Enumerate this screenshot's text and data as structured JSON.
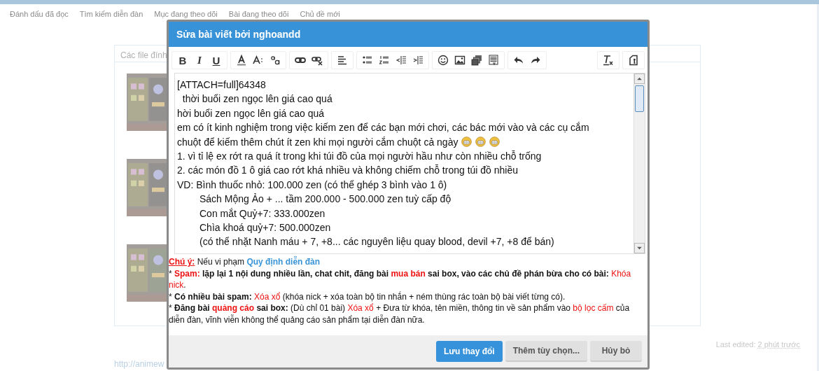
{
  "nav": [
    "Đánh dấu đã đọc",
    "Tìm kiếm diễn đàn",
    "Mục đang theo dõi",
    "Bài đang theo dõi",
    "Chủ đề mới"
  ],
  "attachments": {
    "title": "Các file đính"
  },
  "footer_link": "http://animew",
  "last_edited": {
    "label": "Last edited:",
    "time": "2 phút trước"
  },
  "dialog": {
    "title": "Sửa bài viết bởi nghoandd",
    "toolbar": {
      "format_buttons": [
        "B",
        "I",
        "U"
      ]
    },
    "editor_lines": [
      {
        "kind": "line",
        "text": "[ATTACH=full]64348"
      },
      {
        "kind": "line",
        "text": "  thời buổi zen ngọc lên giá cao quá"
      },
      {
        "kind": "line",
        "text": "hời buổi zen ngọc lên giá cao quá"
      },
      {
        "kind": "line",
        "text": "em có ít kinh nghiệm trong việc kiếm zen để các bạn mới chơi, các bác mới vào và các cụ cắm"
      },
      {
        "kind": "emoticons",
        "text": "chuột để kiếm thêm chút ít zen khi mọi người cắm chuột cả ngày"
      },
      {
        "kind": "line",
        "text": "1. vì tỉ lệ ex rớt ra quá ít trong khi túi đồ của mọi người hầu như còn nhiều chỗ trống"
      },
      {
        "kind": "line",
        "text": "2. các món đồ 1 ô giá cao rớt khá nhiều và không chiếm chỗ trong túi đồ nhiều"
      },
      {
        "kind": "line",
        "text": "VD: Bình thuốc nhỏ: 100.000 zen (có thể ghép 3 bình vào 1 ô)"
      },
      {
        "kind": "indented",
        "text": "Sách Mộng Ảo + ... tầm 200.000 - 500.000 zen tuỳ cấp độ"
      },
      {
        "kind": "indented",
        "text": "Con mắt Quỷ+7: 333.000zen"
      },
      {
        "kind": "indented",
        "text": "Chìa khoá quỷ+7: 500.000zen"
      },
      {
        "kind": "indented",
        "text": "(có thể nhặt Nanh máu + 7, +8... các nguyên liệu quay blood, devil +7, +8 để bán)"
      }
    ],
    "rules": [
      [
        {
          "kind": "warn",
          "text": "Chú ý:"
        },
        {
          "kind": "plain",
          "text": " Nếu vi phạm "
        },
        {
          "kind": "link",
          "text": "Quy định diễn đàn"
        }
      ],
      [
        {
          "kind": "plain",
          "text": "* "
        },
        {
          "kind": "redbold",
          "text": "Spam:"
        },
        {
          "kind": "bold",
          "text": " lặp lại 1 nội dung nhiều lần, chat chit, đăng bài "
        },
        {
          "kind": "redbold",
          "text": "mua bán"
        },
        {
          "kind": "bold",
          "text": " sai box, vào các chủ đề phán bừa cho có bài:"
        },
        {
          "kind": "red",
          "text": " Khóa nick"
        },
        {
          "kind": "plain",
          "text": "."
        }
      ],
      [
        {
          "kind": "plain",
          "text": "* "
        },
        {
          "kind": "bold",
          "text": "Có nhiều bài spam:"
        },
        {
          "kind": "red",
          "text": " Xóa xổ"
        },
        {
          "kind": "plain",
          "text": " (khóa nick + xóa toàn bộ tin nhắn + ném thùng rác toàn bộ bài viết từng có)."
        }
      ],
      [
        {
          "kind": "plain",
          "text": "* "
        },
        {
          "kind": "bold",
          "text": "Đăng bài "
        },
        {
          "kind": "redbold",
          "text": "quảng cáo"
        },
        {
          "kind": "bold",
          "text": " sai box:"
        },
        {
          "kind": "plain",
          "text": " (Dù chỉ 01 bài) "
        },
        {
          "kind": "red",
          "text": "Xóa xổ"
        },
        {
          "kind": "plain",
          "text": " + Đưa từ khóa, tên miền, thông tin về sản phẩm vào "
        },
        {
          "kind": "red",
          "text": "bộ lọc cấm"
        },
        {
          "kind": "plain",
          "text": " của diễn đàn, vĩnh viễn không thể quảng cáo sản phẩm tại diễn đàn nữa."
        }
      ]
    ],
    "buttons": [
      {
        "kind": "primary",
        "label": "Lưu thay đổi"
      },
      {
        "kind": "secondary",
        "label": "Thêm tùy chọn..."
      },
      {
        "kind": "secondary",
        "label": "Hủy bỏ"
      }
    ]
  }
}
